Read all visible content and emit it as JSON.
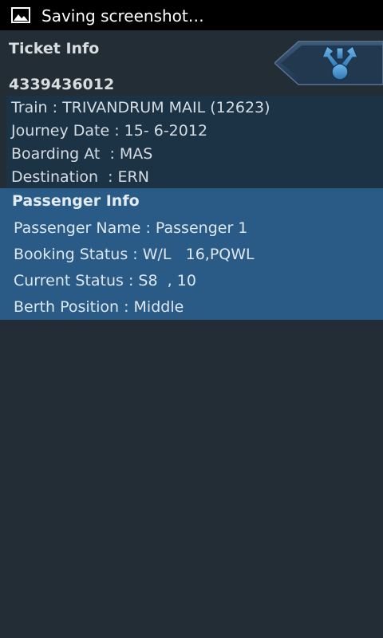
{
  "status_bar": {
    "notification_icon": "image-icon",
    "text": "Saving screenshot…"
  },
  "header": {
    "title": "Ticket Info",
    "pnr": "4339436012",
    "back_icon": "back-arrow-icon"
  },
  "journey": {
    "train": "Train : TRIVANDRUM MAIL (12623)",
    "journey_date": "Journey Date : 15- 6-2012",
    "boarding_at": "Boarding At  : MAS",
    "destination": "Destination  : ERN"
  },
  "passenger": {
    "title": "Passenger Info",
    "name": "Passenger Name : Passenger 1",
    "booking_status": "Booking Status : W/L   16,PQWL",
    "current_status": "Current Status : S8  , 10",
    "berth_position": "Berth Position : Middle"
  },
  "colors": {
    "background": "#232d35",
    "status_bar": "#000000",
    "journey_block": "#1c3346",
    "passenger_block": "#2a5b86"
  }
}
